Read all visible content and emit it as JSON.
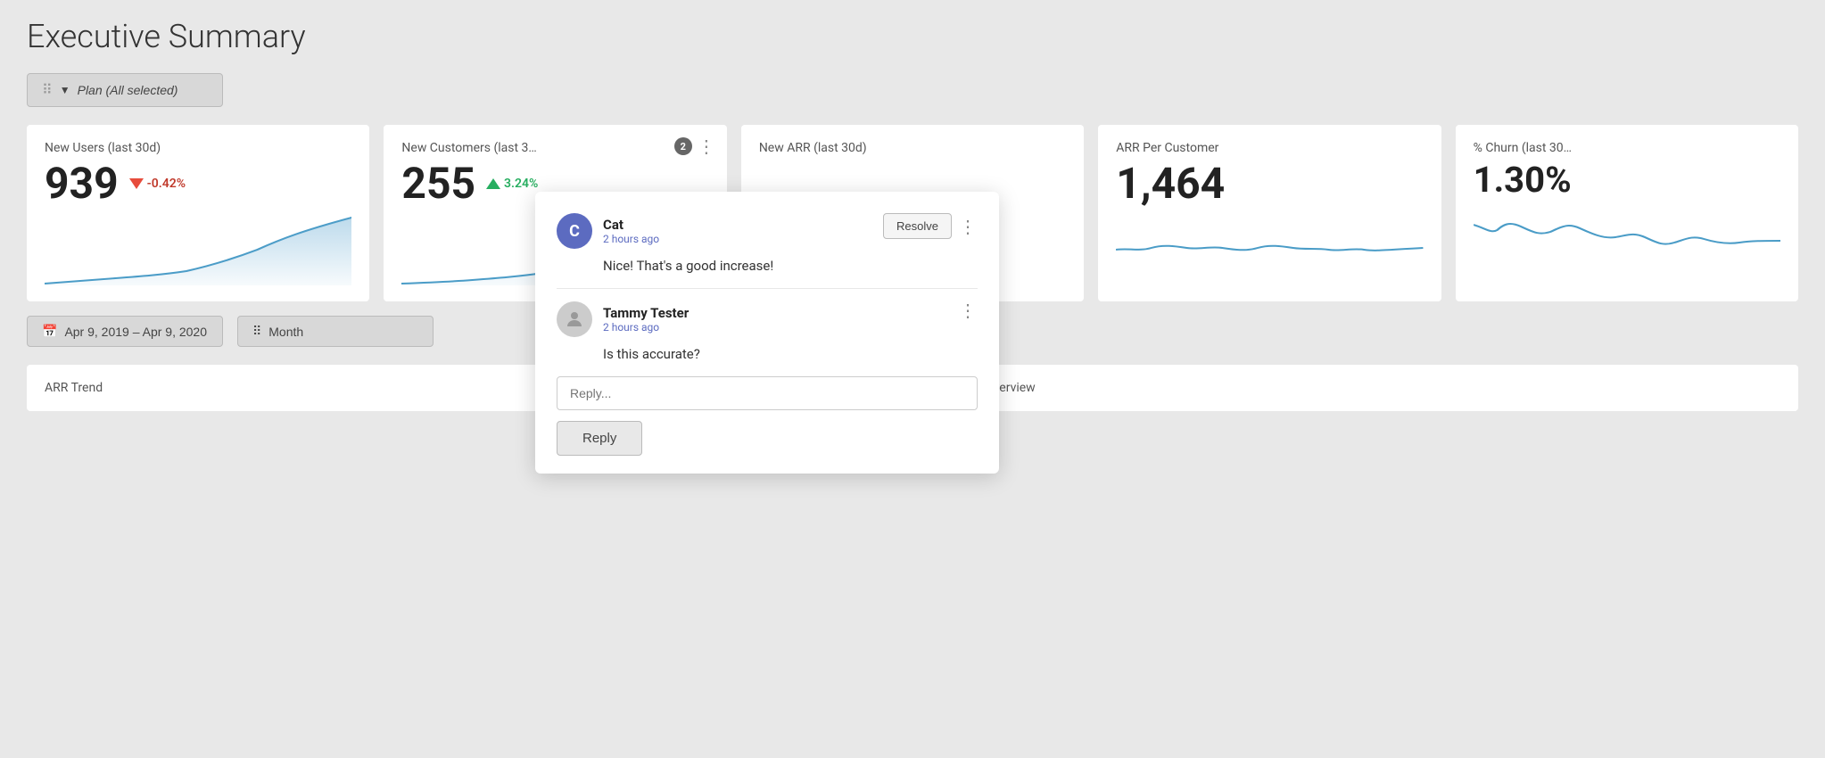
{
  "page": {
    "title": "Executive Summary"
  },
  "filter": {
    "drag_label": "⠿",
    "icon": "▼",
    "label": "Plan (All selected)"
  },
  "cards": [
    {
      "id": "new-users",
      "title": "New Users (last 30d)",
      "value": "939",
      "change": "-0.42%",
      "direction": "down",
      "has_comment": false,
      "comment_count": null
    },
    {
      "id": "new-customers",
      "title": "New Customers (last 3",
      "value": "255",
      "change": "3.24%",
      "direction": "up",
      "has_comment": true,
      "comment_count": "2"
    },
    {
      "id": "new-arr",
      "title": "New ARR (last 30d)",
      "value": "",
      "change": "",
      "direction": "",
      "has_comment": false,
      "comment_count": null
    },
    {
      "id": "arr-per-customer",
      "title": "ARR Per Customer",
      "value": "1,464",
      "change": "",
      "direction": "",
      "has_comment": false,
      "comment_count": null
    },
    {
      "id": "pct-churn",
      "title": "% Churn (last 30",
      "value": "1.30%",
      "change": "",
      "direction": "",
      "has_comment": false,
      "comment_count": null
    }
  ],
  "date_filter": {
    "icon": "📅",
    "label": "Apr 9, 2019 – Apr 9, 2020"
  },
  "granularity_filter": {
    "icon": "⠿",
    "label": "Month"
  },
  "bottom_sections": [
    {
      "title": "ARR Trend"
    },
    {
      "title": "Pipeline Overview"
    }
  ],
  "comment_popup": {
    "comments": [
      {
        "id": "cat",
        "author": "Cat",
        "avatar_letter": "C",
        "time": "2 hours ago",
        "text": "Nice! That's a good increase!",
        "has_resolve": true
      },
      {
        "id": "tammy",
        "author": "Tammy Tester",
        "avatar_letter": "",
        "time": "2 hours ago",
        "text": "Is this accurate?",
        "has_resolve": false
      }
    ],
    "reply_placeholder": "Reply...",
    "reply_button": "Reply",
    "resolve_label": "Resolve"
  }
}
